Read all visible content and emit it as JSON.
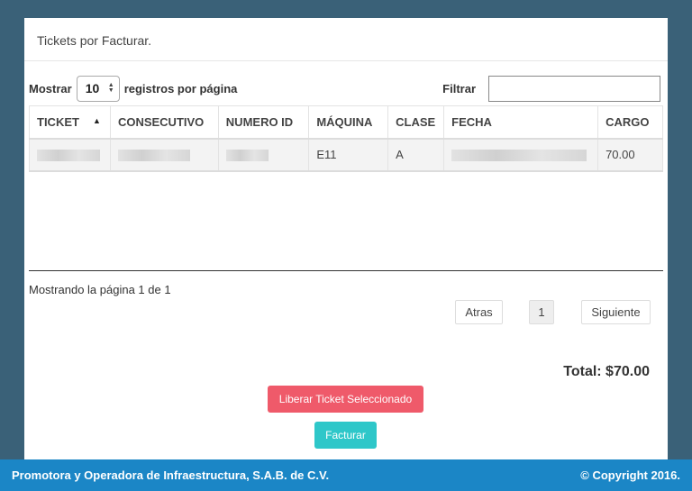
{
  "panel": {
    "title": "Tickets por Facturar."
  },
  "controls": {
    "show_label": "Mostrar",
    "page_length": "10",
    "per_page_label": "registros por página",
    "filter_label": "Filtrar",
    "filter_value": ""
  },
  "table": {
    "columns": [
      "TICKET",
      "CONSECUTIVO",
      "NUMERO ID",
      "MÁQUINA",
      "CLASE",
      "FECHA",
      "CARGO"
    ],
    "sorted_column": "TICKET",
    "sort_direction": "ascending",
    "rows": [
      {
        "ticket": "",
        "consecutivo": "",
        "numero_id": "",
        "maquina": "E11",
        "clase": "A",
        "fecha": "",
        "cargo": "70.00"
      }
    ]
  },
  "pagination": {
    "info": "Mostrando la página 1 de 1",
    "prev_label": "Atras",
    "current_page": "1",
    "next_label": "Siguiente"
  },
  "summary": {
    "total": "Total: $70.00"
  },
  "actions": {
    "release_label": "Liberar Ticket Seleccionado",
    "invoice_label": "Facturar"
  },
  "footer": {
    "company": "Promotora y Operadora de Infraestructura, S.A.B. de C.V.",
    "copyright": "© Copyright 2016."
  },
  "colors": {
    "background": "#3a6178",
    "footer": "#1b86c6",
    "release_button": "#ef5a6a",
    "invoice_button": "#2ec7c9"
  },
  "icons": {
    "sort": "sort-asc-icon",
    "select_arrows": "updown-arrows-icon"
  }
}
